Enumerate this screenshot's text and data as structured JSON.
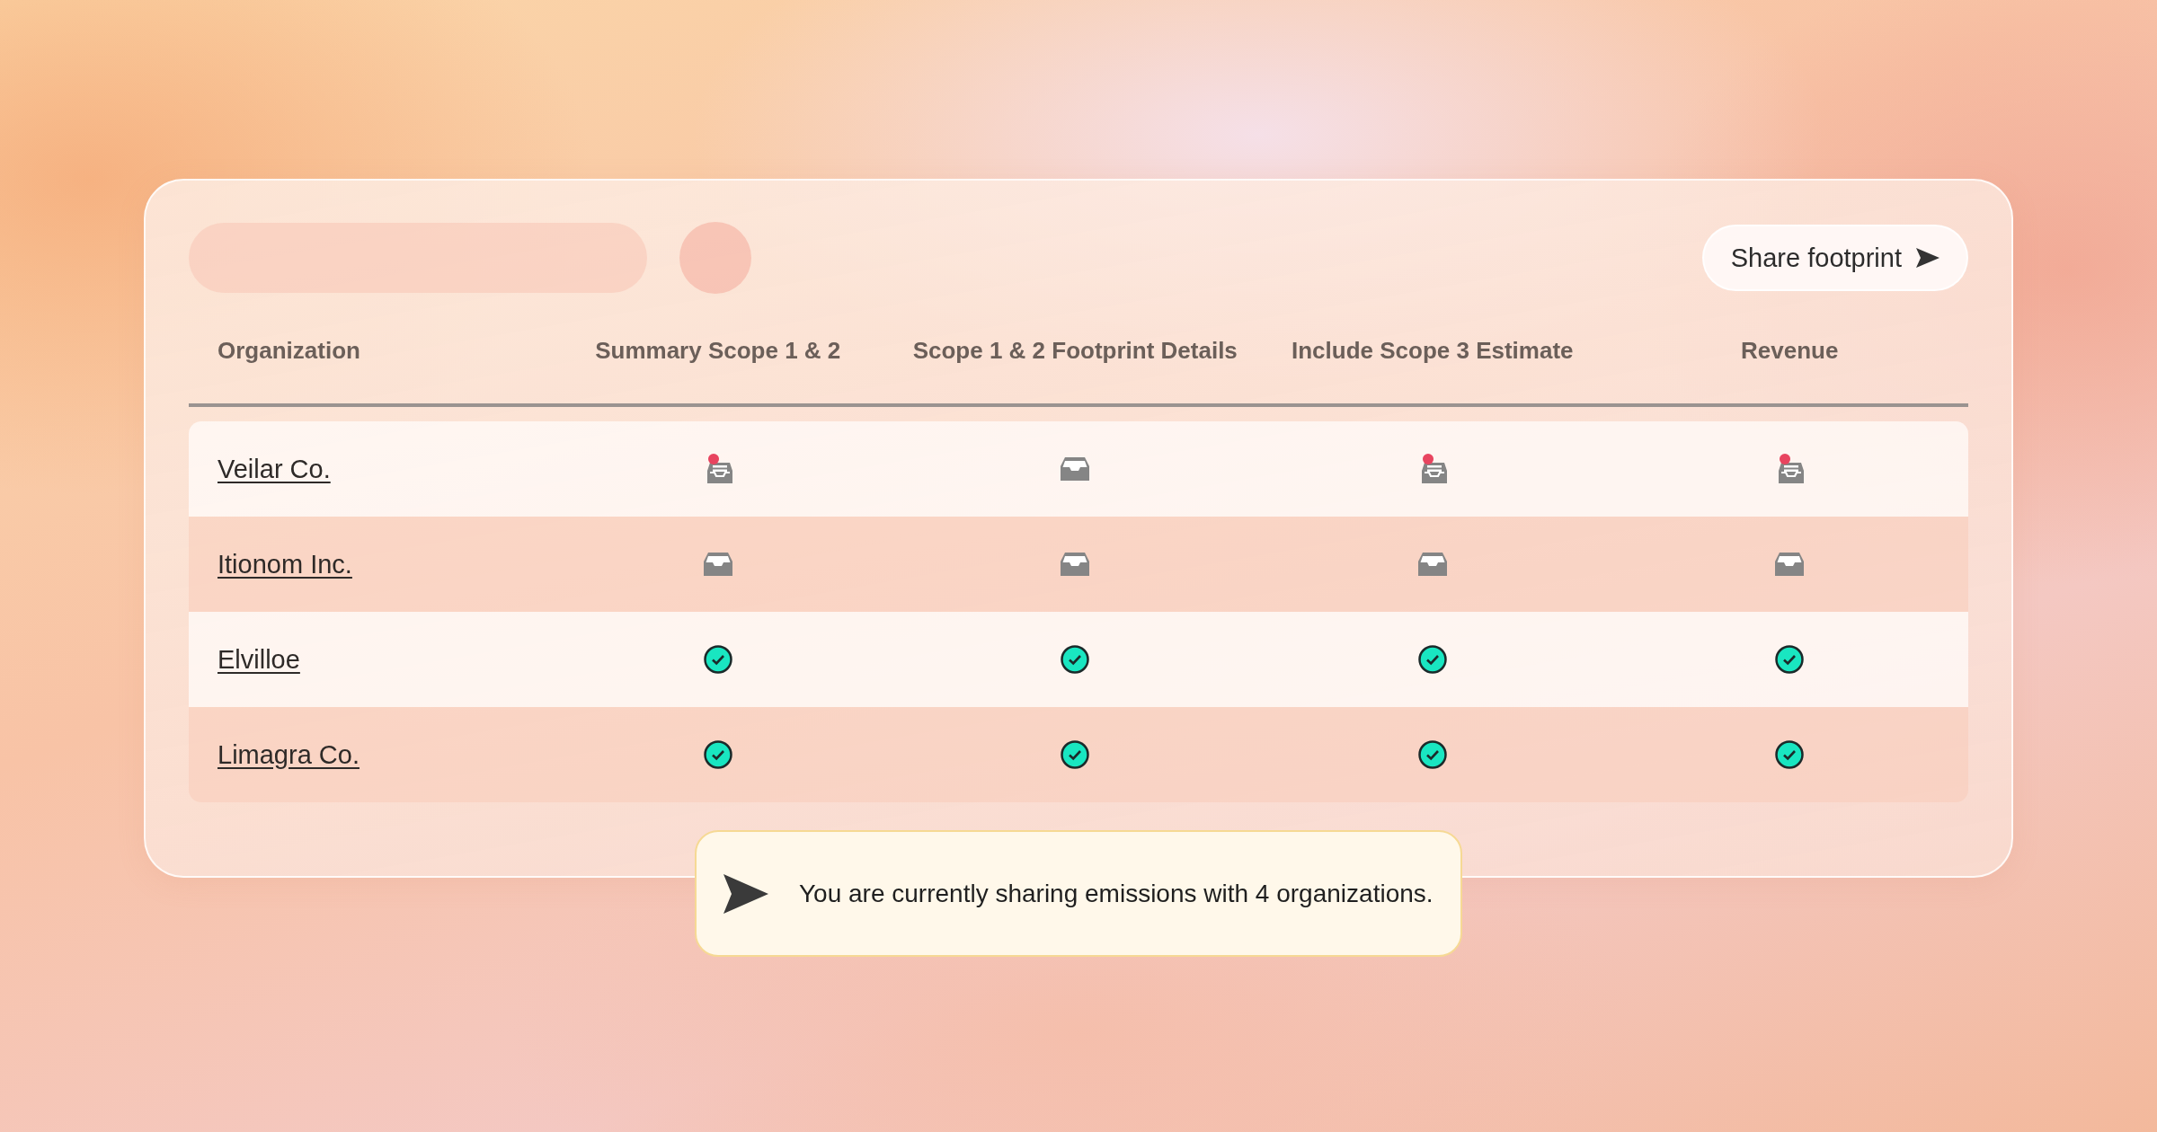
{
  "share_button": {
    "label": "Share footprint"
  },
  "table": {
    "columns": [
      "Organization",
      "Summary Scope 1 & 2",
      "Scope 1 & 2 Footprint Details",
      "Include Scope 3 Estimate",
      "Revenue"
    ],
    "rows": [
      {
        "name": "Veilar Co.",
        "cells": [
          {
            "kind": "new"
          },
          {
            "kind": "empty"
          },
          {
            "kind": "new"
          },
          {
            "kind": "new"
          }
        ]
      },
      {
        "name": "Itionom Inc.",
        "cells": [
          {
            "kind": "empty"
          },
          {
            "kind": "empty"
          },
          {
            "kind": "empty"
          },
          {
            "kind": "empty"
          }
        ]
      },
      {
        "name": "Elvilloe",
        "cells": [
          {
            "kind": "done"
          },
          {
            "kind": "done"
          },
          {
            "kind": "done"
          },
          {
            "kind": "done"
          }
        ]
      },
      {
        "name": "Limagra Co.",
        "cells": [
          {
            "kind": "done"
          },
          {
            "kind": "done"
          },
          {
            "kind": "done"
          },
          {
            "kind": "done"
          }
        ]
      }
    ]
  },
  "toast": {
    "message": "You are currently sharing emissions with 4 organizations."
  }
}
